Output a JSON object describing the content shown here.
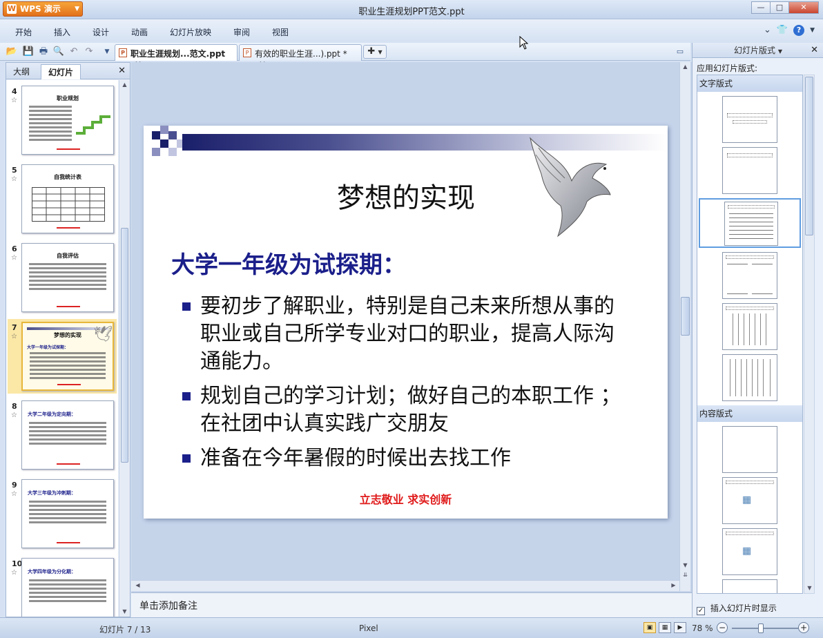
{
  "app": {
    "brand": "WPS 演示",
    "window_title": "职业生涯规划PPT范文.ppt"
  },
  "menu": [
    "开始",
    "插入",
    "设计",
    "动画",
    "幻灯片放映",
    "审阅",
    "视图"
  ],
  "doc_tabs": [
    {
      "label": "职业生涯规划...范文.ppt",
      "active": true
    },
    {
      "label": "有效的职业生涯...).ppt *",
      "active": false
    }
  ],
  "left_pane": {
    "tabs": [
      "大纲",
      "幻灯片"
    ],
    "active_tab": "幻灯片",
    "thumbnails": [
      {
        "num": "4",
        "title": "职业规划"
      },
      {
        "num": "5",
        "title": "自我统计表"
      },
      {
        "num": "6",
        "title": "自我评估"
      },
      {
        "num": "7",
        "title": "梦想的实现",
        "subtitle": "大学一年级为试探期：",
        "selected": true
      },
      {
        "num": "8",
        "title": "大学二年级为定向期："
      },
      {
        "num": "9",
        "title": "大学三年级为冲刺期："
      },
      {
        "num": "10",
        "title": "大学四年级为分化期："
      }
    ]
  },
  "slide": {
    "title": "梦想的实现",
    "subtitle": "大学一年级为试探期：",
    "bullets": [
      "要初步了解职业，特别是自己未来所想从事的职业或自己所学专业对口的职业，提高人际沟通能力。",
      "规划自己的学习计划；做好自己的本职工作 ；在社团中认真实践广交朋友",
      "准备在今年暑假的时候出去找工作"
    ],
    "footer": "立志敬业  求实创新",
    "colors": {
      "subtitle": "#1b1f8a",
      "footer": "#e01a1a"
    }
  },
  "notes_placeholder": "单击添加备注",
  "right_pane": {
    "header": "幻灯片版式",
    "apply_label": "应用幻灯片版式:",
    "sections": [
      "文字版式",
      "内容版式"
    ],
    "checkbox_label": "插入幻灯片时显示",
    "checkbox_checked": true
  },
  "status": {
    "slide_counter": "幻灯片 7 / 13",
    "theme": "Pixel",
    "zoom": "78 %"
  }
}
